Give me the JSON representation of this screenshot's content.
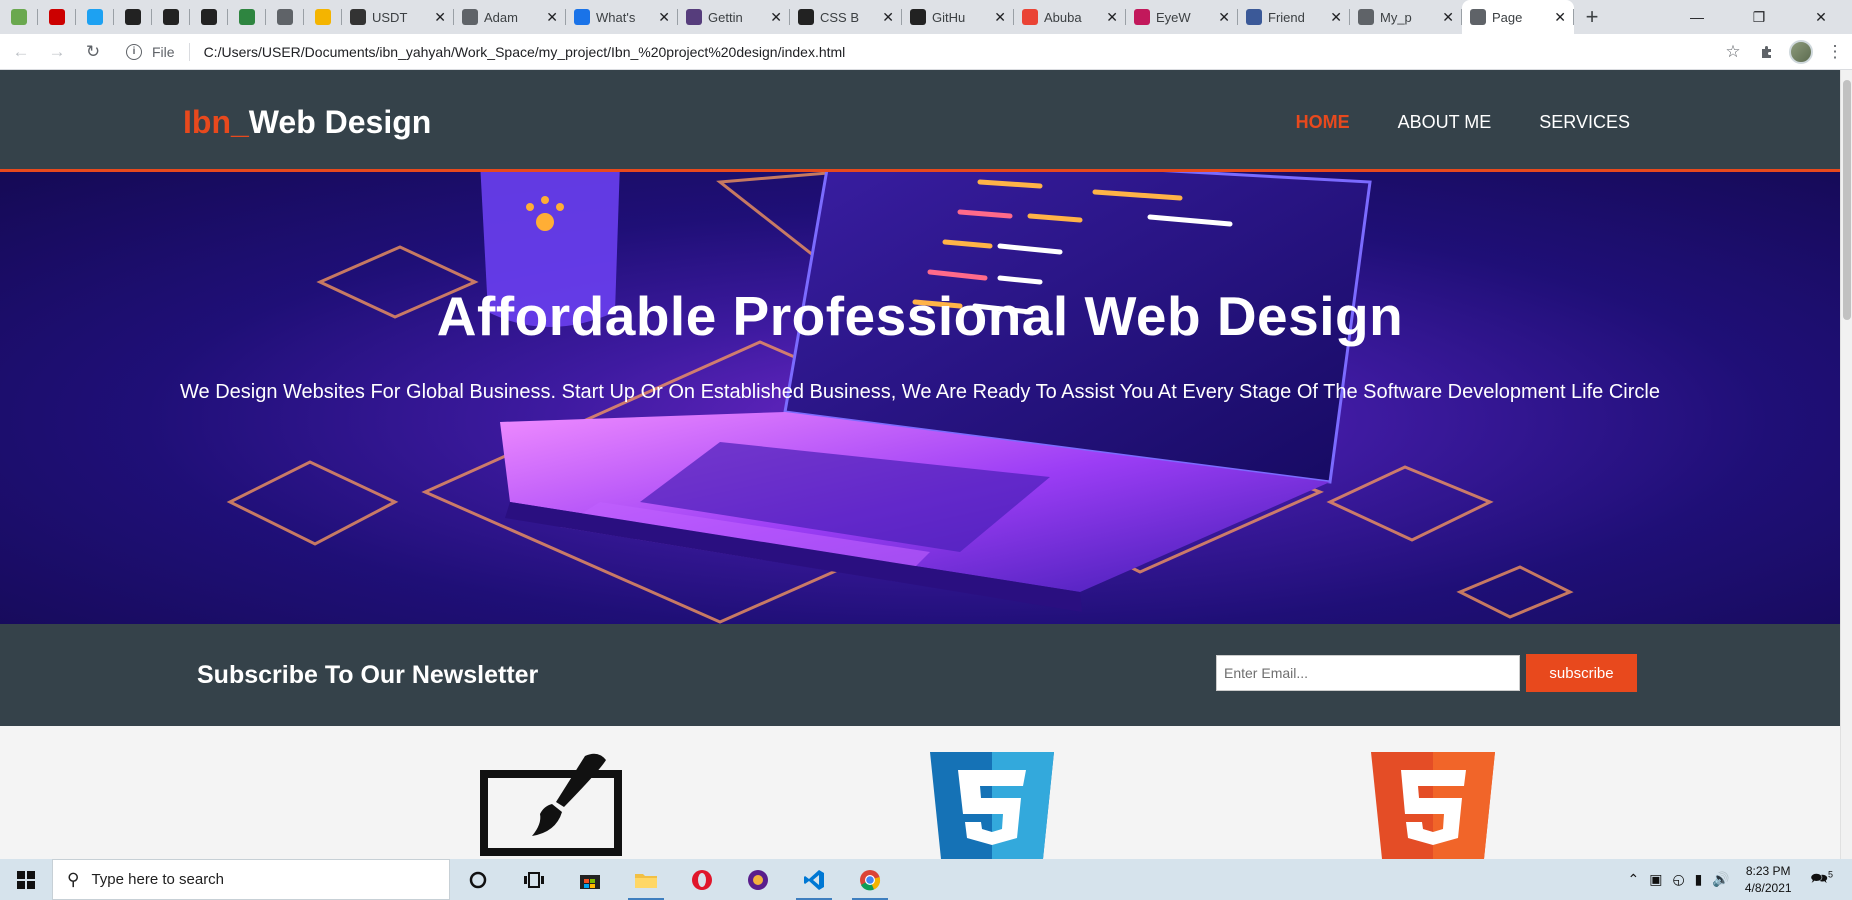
{
  "browser": {
    "tabs": [
      {
        "title": "",
        "favicon_color": "#6aa84f",
        "small": true
      },
      {
        "title": "",
        "favicon_color": "#cc0000",
        "small": true
      },
      {
        "title": "",
        "favicon_color": "#1da1f2",
        "small": true
      },
      {
        "title": "",
        "favicon_color": "#222222",
        "small": true
      },
      {
        "title": "",
        "favicon_color": "#222222",
        "small": true
      },
      {
        "title": "",
        "favicon_color": "#222222",
        "small": true
      },
      {
        "title": "",
        "favicon_color": "#2e8540",
        "small": true
      },
      {
        "title": "",
        "favicon_color": "#5f6368",
        "small": true
      },
      {
        "title": "",
        "favicon_color": "#f4b400",
        "small": true
      },
      {
        "title": "USDT",
        "favicon_color": "#333333"
      },
      {
        "title": "Adam",
        "favicon_color": "#5f6368"
      },
      {
        "title": "What's",
        "favicon_color": "#1a73e8"
      },
      {
        "title": "Gettin",
        "favicon_color": "#563d7c"
      },
      {
        "title": "CSS B",
        "favicon_color": "#222222"
      },
      {
        "title": "GitHu",
        "favicon_color": "#222222"
      },
      {
        "title": "Abuba",
        "favicon_color": "#ea4335"
      },
      {
        "title": "EyeW",
        "favicon_color": "#c2185b"
      },
      {
        "title": "Friend",
        "favicon_color": "#3b5998"
      },
      {
        "title": "My_p",
        "favicon_color": "#5f6368"
      },
      {
        "title": "Page",
        "favicon_color": "#5f6368",
        "active": true
      }
    ],
    "new_tab": "+",
    "url_scheme": "File",
    "url": "C:/Users/USER/Documents/ibn_yahyah/Work_Space/my_project/Ibn_%20project%20design/index.html"
  },
  "site": {
    "brand_highlight": "Ibn_",
    "brand_rest": "Web Design",
    "nav": [
      {
        "label": "HOME",
        "current": true
      },
      {
        "label": "ABOUT ME",
        "current": false
      },
      {
        "label": "SERVICES",
        "current": false
      }
    ],
    "hero_title": "Affordable Professional Web Design",
    "hero_text": "We Design Websites For Global Business. Start Up Or On Established Business, We Are Ready To Assist You At Every Stage Of The Software Development Life Circle",
    "newsletter_title": "Subscribe To Our Newsletter",
    "email_placeholder": "Enter Email...",
    "subscribe_label": "subscribe",
    "feature_icons": [
      "brush-monitor-icon",
      "css3-icon",
      "html5-icon"
    ]
  },
  "colors": {
    "header_bg": "#35424a",
    "accent": "#e8491d",
    "page_bg": "#f4f4f4"
  },
  "taskbar": {
    "search_placeholder": "Type here to search",
    "time": "8:23 PM",
    "date": "4/8/2021",
    "notification_count": "5"
  }
}
